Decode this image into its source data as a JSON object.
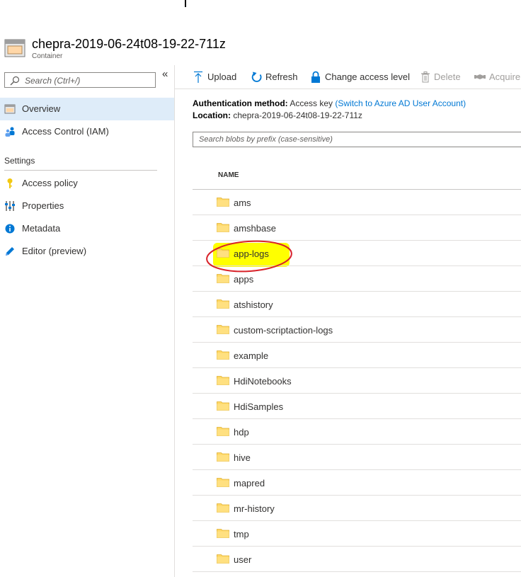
{
  "header": {
    "title": "chepra-2019-06-24t08-19-22-711z",
    "subtitle": "Container"
  },
  "sidebar": {
    "search_placeholder": "Search (Ctrl+/)",
    "collapse_glyph": "«",
    "items": [
      {
        "label": "Overview",
        "icon": "container-icon"
      },
      {
        "label": "Access Control (IAM)",
        "icon": "people-icon"
      }
    ],
    "settings_heading": "Settings",
    "settings_items": [
      {
        "label": "Access policy",
        "icon": "key-icon"
      },
      {
        "label": "Properties",
        "icon": "sliders-icon"
      },
      {
        "label": "Metadata",
        "icon": "info-icon"
      },
      {
        "label": "Editor (preview)",
        "icon": "pencil-icon"
      }
    ]
  },
  "toolbar": {
    "upload": "Upload",
    "refresh": "Refresh",
    "change_access": "Change access level",
    "delete": "Delete",
    "acquire": "Acquire"
  },
  "info": {
    "auth_label": "Authentication method:",
    "auth_value": "Access key",
    "auth_link": "(Switch to Azure AD User Account)",
    "location_label": "Location:",
    "location_value": "chepra-2019-06-24t08-19-22-711z"
  },
  "blob_search_placeholder": "Search blobs by prefix (case-sensitive)",
  "table": {
    "column_name": "NAME",
    "rows": [
      "ams",
      "amshbase",
      "app-logs",
      "apps",
      "atshistory",
      "custom-scriptaction-logs",
      "example",
      "HdiNotebooks",
      "HdiSamples",
      "hdp",
      "hive",
      "mapred",
      "mr-history",
      "tmp",
      "user"
    ],
    "highlighted": "app-logs"
  },
  "colors": {
    "accent": "#0078d4",
    "selected_nav": "#deecf9",
    "folder": "#ffd866",
    "highlight": "#ffff00",
    "annotation_ring": "#d8232a"
  }
}
